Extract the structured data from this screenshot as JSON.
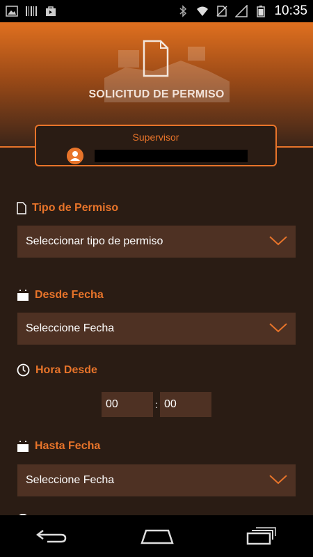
{
  "status": {
    "time": "10:35"
  },
  "header": {
    "title": "SOLICITUD DE PERMISO"
  },
  "supervisor": {
    "label": "Supervisor"
  },
  "form": {
    "tipo_permiso": {
      "label": "Tipo de Permiso",
      "value": "Seleccionar tipo de permiso"
    },
    "desde_fecha": {
      "label": "Desde Fecha",
      "value": "Seleccione Fecha"
    },
    "hora_desde": {
      "label": "Hora Desde",
      "hours": "00",
      "separator": ":",
      "minutes": "00"
    },
    "hasta_fecha": {
      "label": "Hasta Fecha",
      "value": "Seleccione Fecha"
    }
  },
  "colors": {
    "accent": "#e8742a",
    "background": "#2a1c14",
    "field": "#4e3123"
  },
  "icons": {
    "status_left": [
      "picture-icon",
      "barcode-icon",
      "bag-icon"
    ],
    "status_right": [
      "bluetooth-icon",
      "wifi-icon",
      "no-sim-icon",
      "signal-icon",
      "battery-icon"
    ],
    "nav": [
      "back-icon",
      "home-icon",
      "recent-apps-icon"
    ]
  }
}
